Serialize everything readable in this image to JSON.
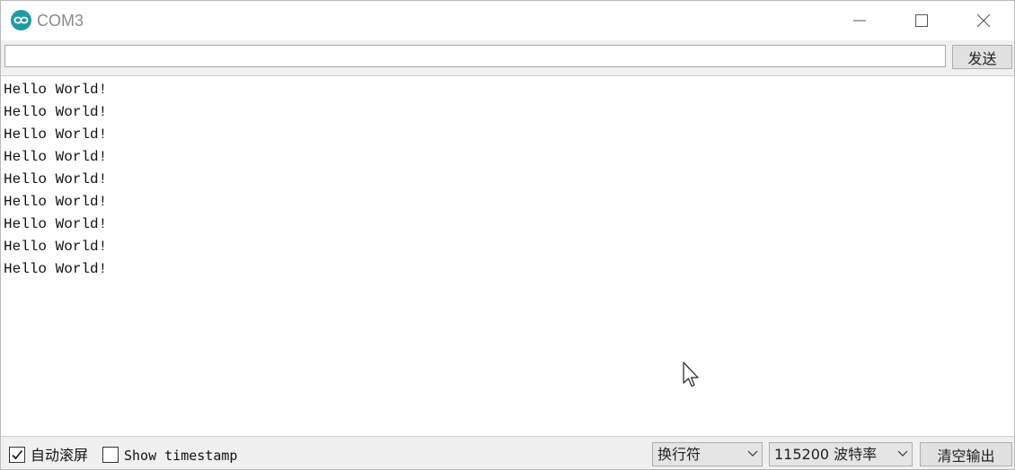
{
  "window": {
    "title": "COM3",
    "icon": "arduino-infinity-icon",
    "controls": [
      "minimize-icon",
      "maximize-icon",
      "close-icon"
    ]
  },
  "send": {
    "input_value": "",
    "button_label": "发送"
  },
  "output": {
    "lines": [
      "Hello World!",
      "Hello World!",
      "Hello World!",
      "Hello World!",
      "Hello World!",
      "Hello World!",
      "Hello World!",
      "Hello World!",
      "Hello World!"
    ]
  },
  "footer": {
    "autoscroll": {
      "label": "自动滚屏",
      "checked": true
    },
    "timestamp": {
      "label": "Show timestamp",
      "checked": false
    },
    "line_ending": {
      "selected": "换行符"
    },
    "baud_rate": {
      "selected": "115200 波特率"
    },
    "clear_button_label": "清空输出"
  },
  "colors": {
    "accent": "#1f9aa3",
    "title_text": "#8a8a8a",
    "button_bg": "#e1e1e1"
  }
}
